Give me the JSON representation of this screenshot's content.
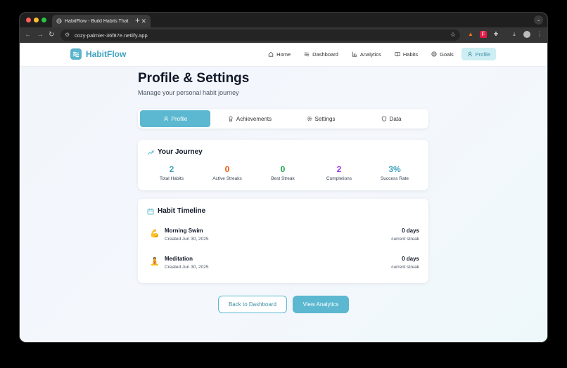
{
  "browser": {
    "tab_title": "HabitFlow - Build Habits That",
    "tab_close": "✕",
    "new_tab": "+",
    "url": "cozy-palmier-36f87e.netlify.app"
  },
  "app": {
    "logo_text": "HabitFlow",
    "nav": [
      {
        "label": "Home",
        "icon": "home-icon"
      },
      {
        "label": "Dashboard",
        "icon": "dashboard-icon"
      },
      {
        "label": "Analytics",
        "icon": "bar-chart-icon"
      },
      {
        "label": "Habits",
        "icon": "book-icon"
      },
      {
        "label": "Goals",
        "icon": "target-icon"
      },
      {
        "label": "Profile",
        "icon": "user-icon",
        "active": true
      }
    ]
  },
  "page": {
    "title": "Profile & Settings",
    "subtitle": "Manage your personal habit journey"
  },
  "tabs": [
    {
      "label": "Profile",
      "icon": "user-icon",
      "active": true
    },
    {
      "label": "Achievements",
      "icon": "award-icon"
    },
    {
      "label": "Settings",
      "icon": "gear-icon"
    },
    {
      "label": "Data",
      "icon": "shield-icon"
    }
  ],
  "journey": {
    "title": "Your Journey",
    "stats": [
      {
        "value": "2",
        "label": "Total Habits",
        "color": "#3fa3bf"
      },
      {
        "value": "0",
        "label": "Active Streaks",
        "color": "#ea580c"
      },
      {
        "value": "0",
        "label": "Best Streak",
        "color": "#16a34a"
      },
      {
        "value": "2",
        "label": "Completions",
        "color": "#9333ea"
      },
      {
        "value": "3%",
        "label": "Success Rate",
        "color": "#3fa3bf"
      }
    ]
  },
  "timeline": {
    "title": "Habit Timeline",
    "habits": [
      {
        "emoji": "💪",
        "name": "Morning Swim",
        "created": "Created Jun 30, 2025",
        "days": "0 days",
        "streak_label": "current streak"
      },
      {
        "emoji": "🧘",
        "name": "Meditation",
        "created": "Created Jun 30, 2025",
        "days": "0 days",
        "streak_label": "current streak"
      }
    ]
  },
  "actions": {
    "back": "Back to Dashboard",
    "analytics": "View Analytics"
  },
  "colors": {
    "accent": "#5bb8d0",
    "brand": "#3fa3bf"
  }
}
